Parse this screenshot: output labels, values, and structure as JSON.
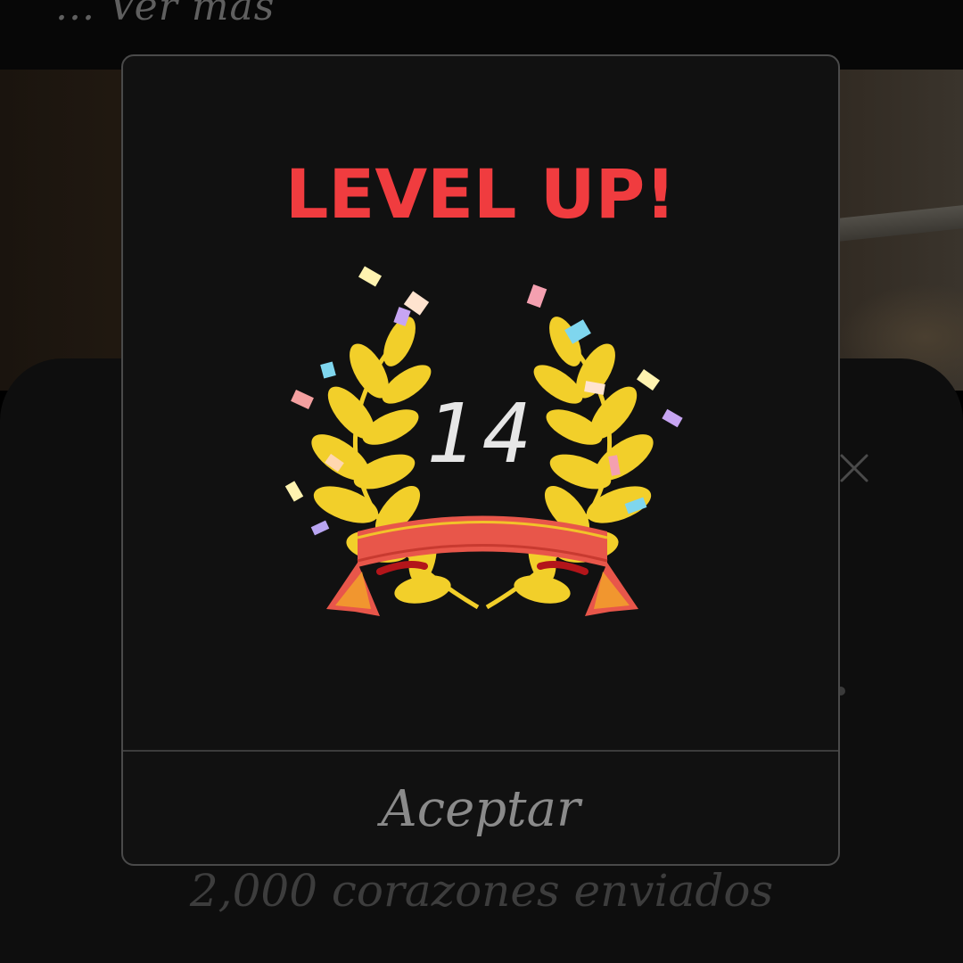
{
  "background": {
    "see_more_text": "... Ver más"
  },
  "sheet": {
    "line1": "2,000 corazones enviados",
    "close_icon": "close-icon"
  },
  "dialog": {
    "title": "LEVEL UP!",
    "level": "14",
    "accept_label": "Aceptar",
    "badge_icon": "laurel-wreath-icon",
    "colors": {
      "title": "#f03c3f",
      "laurel": "#f2cf2a",
      "ribbon": "#e8564a"
    }
  }
}
